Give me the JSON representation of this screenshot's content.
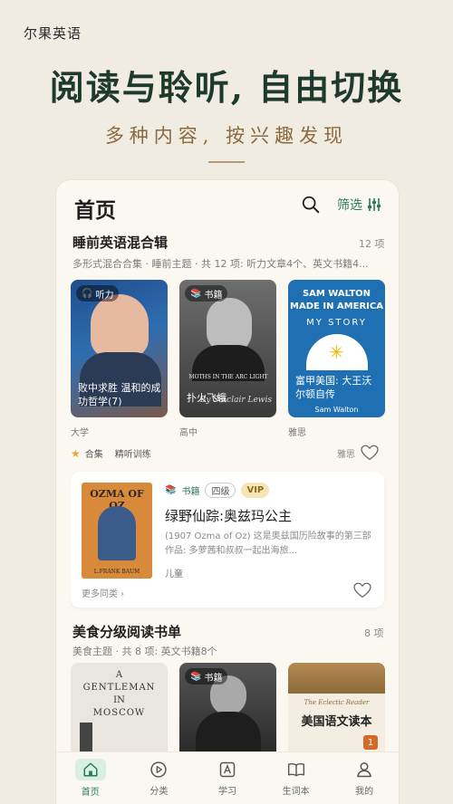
{
  "brand": "尔果英语",
  "headline": "阅读与聆听, 自由切换",
  "subhead": "多种内容, 按兴趣发现",
  "app": {
    "page_title": "首页",
    "filter_label": "筛选"
  },
  "section1": {
    "title": "睡前英语混合辑",
    "count": "12 项",
    "desc": "多形式混合合集 · 睡前主题 · 共 12 项: 听力文章4个、英文书籍4...",
    "cards": [
      {
        "tag": "听力",
        "caption": "败中求胜 温和的成功哲学(7)",
        "level": "大学"
      },
      {
        "tag": "书籍",
        "caption": "扑火飞蛾",
        "cover_text": "MOTHS IN THE ARC LIGHT",
        "cover_author": "By Sinclair Lewis",
        "level": "高中"
      },
      {
        "tag": "",
        "cover_line1": "SAM WALTON",
        "cover_line2": "MADE IN AMERICA",
        "cover_line3": "MY STORY",
        "caption": "富甲美国: 大王沃尔顿自传",
        "cover_author": "Sam Walton",
        "level": "雅思"
      }
    ],
    "meta_collection": "合集",
    "meta_type": "精听训练",
    "meta_right": "雅思"
  },
  "book": {
    "cover_title": "OZMA OF OZ",
    "cover_author": "L.FRANK BAUM",
    "chip_type": "书籍",
    "chip_level": "四级",
    "chip_vip": "VIP",
    "title": "绿野仙踪:奥兹玛公主",
    "desc": "(1907 Ozma of Oz) 这是奥兹国历险故事的第三部作品: 多萝茜和叔叔一起出海旅...",
    "genre": "儿童",
    "more": "更多同类 ›"
  },
  "section2": {
    "title": "美食分级阅读书单",
    "count": "8 项",
    "desc": "美食主题 · 共 8 项: 英文书籍8个",
    "shelf": [
      {
        "line1": "A",
        "line2": "GENTLEMAN",
        "line3": "IN",
        "line4": "MOSCOW"
      },
      {
        "tag": "书籍"
      },
      {
        "small": "The Eclectic Reader",
        "title": "美国语文读本",
        "badge": "1"
      }
    ]
  },
  "tabs": [
    {
      "label": "首页",
      "icon": "home-icon"
    },
    {
      "label": "分类",
      "icon": "play-circle-icon"
    },
    {
      "label": "学习",
      "icon": "a-box-icon"
    },
    {
      "label": "生词本",
      "icon": "book-icon"
    },
    {
      "label": "我的",
      "icon": "person-icon"
    }
  ],
  "colors": {
    "accent": "#2b7a57",
    "headline": "#1d3a2c",
    "subhead": "#8a6a3e",
    "background": "#f1ece1"
  }
}
